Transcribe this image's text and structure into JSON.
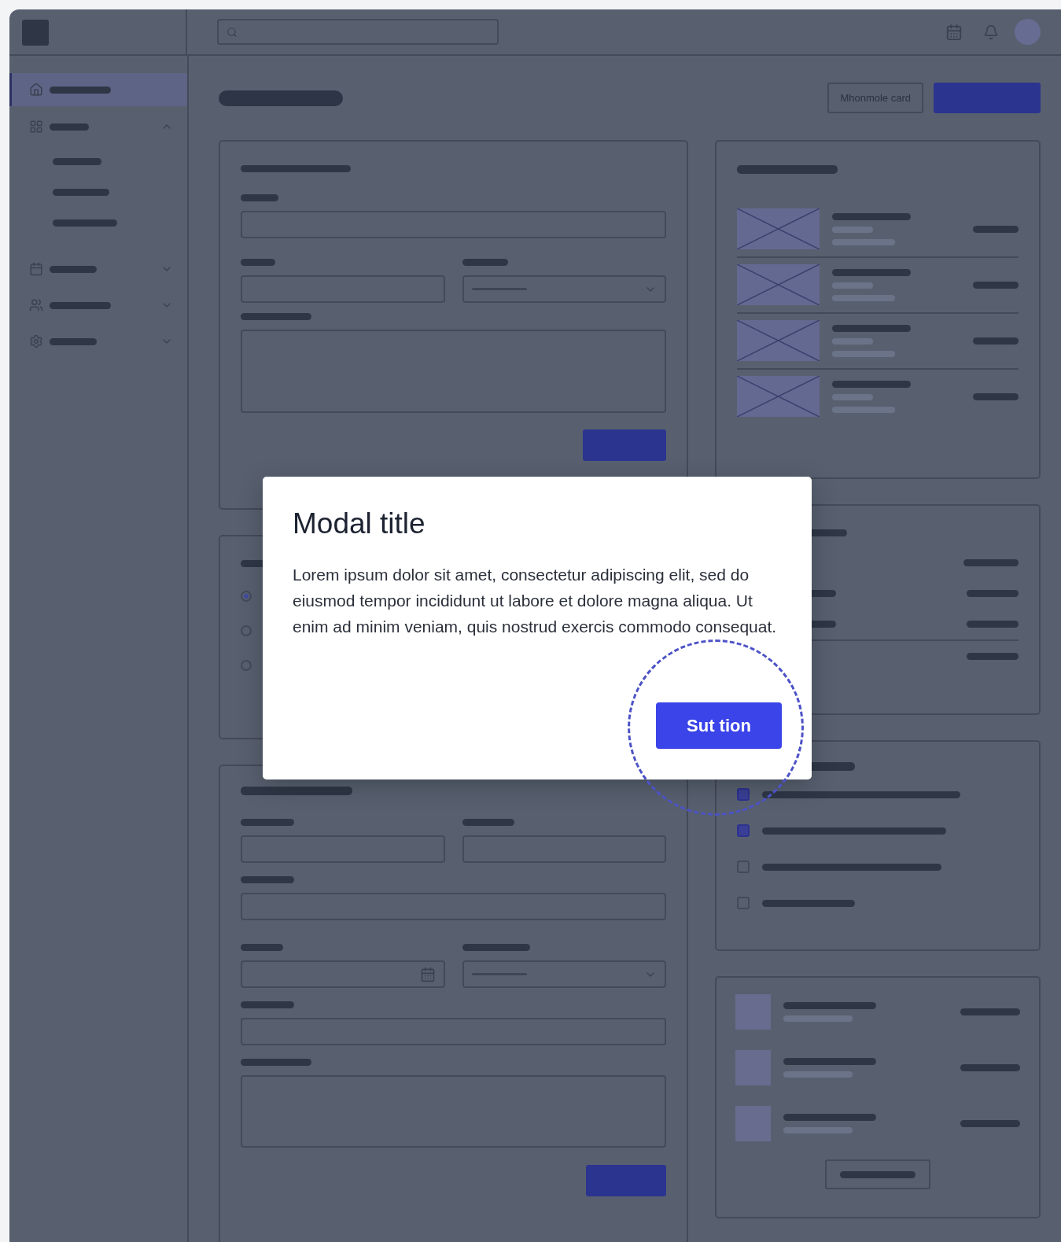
{
  "sidebar": {
    "items": [
      {
        "selected": true
      },
      {
        "selected": false,
        "expanded": true,
        "children": [
          {
            "selected": false
          },
          {
            "selected": false
          },
          {
            "selected": false
          }
        ]
      },
      {
        "selected": false,
        "expanded": false
      },
      {
        "selected": false,
        "expanded": false
      },
      {
        "selected": false,
        "expanded": false
      }
    ]
  },
  "page_actions": [
    {
      "kind": "outline",
      "label": "Mhonmole card"
    },
    {
      "kind": "primary"
    }
  ],
  "radios": [
    {
      "selected": true
    },
    {
      "selected": false
    },
    {
      "selected": false
    }
  ],
  "checklist": [
    {
      "checked": true
    },
    {
      "checked": true
    },
    {
      "checked": false
    },
    {
      "checked": false
    }
  ],
  "modal": {
    "title": "Modal title",
    "body": "Lorem ipsum dolor sit amet, consectetur adipiscing elit, sed do eiusmod tempor incididunt ut labore et dolore magna aliqua. Ut enim ad minim veniam, quis nostrud exercis commodo consequat.",
    "button": "Sut tion",
    "highlighted": true
  }
}
